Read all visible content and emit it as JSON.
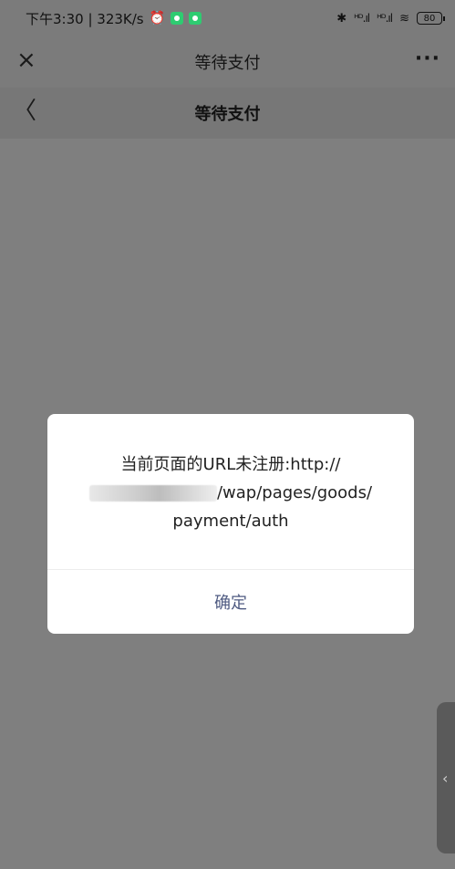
{
  "status_bar": {
    "time_and_speed": "下午3:30 | 323K/s",
    "alarm_icon": "alarm-clock-icon",
    "app_icons": [
      {
        "name": "notification-app-icon",
        "color": "#2ecc71"
      },
      {
        "name": "wechat-icon",
        "color": "#2ecc71"
      }
    ],
    "bluetooth_glyph": "✱",
    "signal_1": "ᴴᴰ.ıl",
    "signal_2": "ᴴᴰ.ıl",
    "wifi_glyph": "≋",
    "battery": "80"
  },
  "outer_bar": {
    "close_glyph": "×",
    "title": "等待支付",
    "more_glyph": "···"
  },
  "inner_bar": {
    "back_glyph": "〈",
    "title": "等待支付"
  },
  "dialog": {
    "message_line1": "当前页面的URL未注册:http://",
    "message_line2_suffix": "/wap/pages/goods/",
    "message_line3": "payment/auth",
    "ok_label": "确定"
  },
  "side_handle": {
    "glyph": "‹"
  }
}
